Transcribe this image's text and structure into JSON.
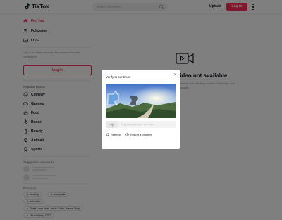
{
  "header": {
    "logo_text": "TikTok",
    "search_placeholder": "Search accounts",
    "upload_label": "Upload",
    "login_label": "Log in"
  },
  "sidebar": {
    "nav": [
      {
        "label": "For You",
        "icon": "home-icon",
        "active": true
      },
      {
        "label": "Following",
        "icon": "following-icon",
        "active": false
      },
      {
        "label": "LIVE",
        "icon": "live-icon",
        "active": false
      }
    ],
    "login_hint": "Log in to follow creators, like videos, and view comments.",
    "login_button": "Log in",
    "popular_topics_title": "Popular topics",
    "topics": [
      {
        "label": "Comedy",
        "icon": "comedy-icon"
      },
      {
        "label": "Gaming",
        "icon": "gaming-icon"
      },
      {
        "label": "Food",
        "icon": "food-icon"
      },
      {
        "label": "Dance",
        "icon": "dance-icon"
      },
      {
        "label": "Beauty",
        "icon": "beauty-icon"
      },
      {
        "label": "Animals",
        "icon": "animals-icon"
      },
      {
        "label": "Sports",
        "icon": "sports-icon"
      }
    ],
    "suggested_title": "Suggested accounts",
    "discover_title": "Discover",
    "tags": [
      {
        "label": "trending",
        "icon": "hashtag"
      },
      {
        "label": "beautydiet",
        "icon": "hashtag"
      },
      {
        "label": "italo vibes",
        "icon": "hashtag"
      },
      {
        "label": "That's Lame (feat. Jacob Collier, Nunes, Sina)",
        "icon": "music"
      },
      {
        "label": "House Party · DDG",
        "icon": "music"
      }
    ]
  },
  "main": {
    "title": "Video not available",
    "subtitle": "Browse our trending creators, hashtags, and sounds."
  },
  "modal": {
    "title": "Verify to continue:",
    "slider_hint": "Drag the puzzle piece into place",
    "refresh_label": "Refresh",
    "report_label": "Report a problem"
  },
  "colors": {
    "brand_red": "#fe2c55",
    "overlay": "rgba(0,0,0,0.5)"
  }
}
